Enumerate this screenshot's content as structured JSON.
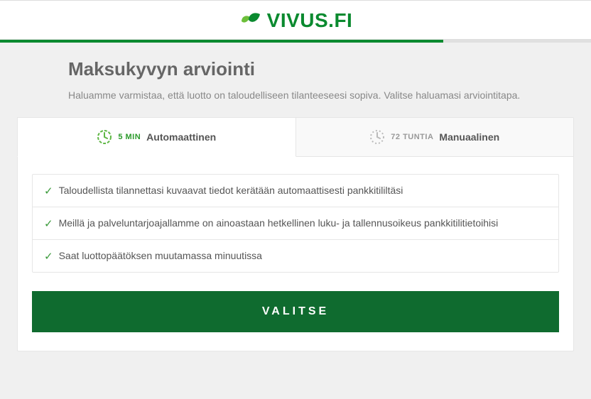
{
  "brand": "VIVUS.FI",
  "intro": {
    "title": "Maksukyvyn arviointi",
    "body": "Haluamme varmistaa, että luotto on taloudelliseen tilanteeseesi sopiva. Valitse haluamasi arviointitapa."
  },
  "tabs": {
    "auto": {
      "duration": "5 MIN",
      "label": "Automaattinen"
    },
    "manual": {
      "duration": "72 TUNTIA",
      "label": "Manuaalinen"
    }
  },
  "benefits": [
    "Taloudellista tilannettasi kuvaavat tiedot kerätään automaattisesti pankkitililtäsi",
    "Meillä ja palveluntarjoajallamme on ainoastaan hetkellinen luku- ja tallennusoikeus pankkitilitietoihisi",
    "Saat luottopäätöksen muutamassa minuutissa"
  ],
  "cta": "VALITSE"
}
